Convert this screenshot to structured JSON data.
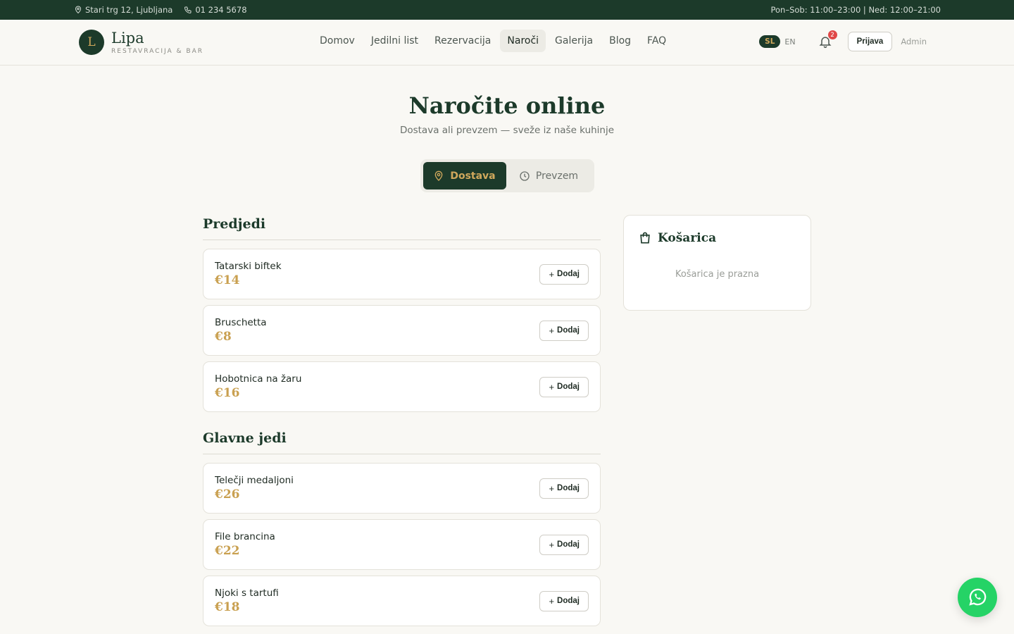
{
  "topbar": {
    "address": "Stari trg 12, Ljubljana",
    "phone": "01 234 5678",
    "hours": "Pon–Sob: 11:00–23:00 | Ned: 12:00–21:00"
  },
  "brand": {
    "initial": "L",
    "name": "Lipa",
    "subtitle": "RESTAVRACIJA & BAR"
  },
  "nav": {
    "items": [
      {
        "label": "Domov"
      },
      {
        "label": "Jedilni list"
      },
      {
        "label": "Rezervacija"
      },
      {
        "label": "Naroči",
        "active": true
      },
      {
        "label": "Galerija"
      },
      {
        "label": "Blog"
      },
      {
        "label": "FAQ"
      }
    ]
  },
  "tools": {
    "lang_active": "SL",
    "lang_other": "EN",
    "notifications": "2",
    "login": "Prijava",
    "admin": "Admin"
  },
  "hero": {
    "title": "Naročite online",
    "subtitle": "Dostava ali prevzem — sveže iz naše kuhinje"
  },
  "mode": {
    "delivery": "Dostava",
    "pickup": "Prevzem"
  },
  "menu": {
    "add_label": "Dodaj",
    "categories": [
      {
        "title": "Predjedi",
        "items": [
          {
            "name": "Tatarski biftek",
            "price": "€14"
          },
          {
            "name": "Bruschetta",
            "price": "€8"
          },
          {
            "name": "Hobotnica na žaru",
            "price": "€16"
          }
        ]
      },
      {
        "title": "Glavne jedi",
        "items": [
          {
            "name": "Telečji medaljoni",
            "price": "€26"
          },
          {
            "name": "File brancina",
            "price": "€22"
          },
          {
            "name": "Njoki s tartufi",
            "price": "€18"
          }
        ]
      }
    ]
  },
  "cart": {
    "title": "Košarica",
    "empty": "Košarica je prazna"
  },
  "colors": {
    "primary": "#1c3a2a",
    "accent": "#c9a050",
    "background": "#f9f8f4",
    "whatsapp": "#25d366"
  }
}
